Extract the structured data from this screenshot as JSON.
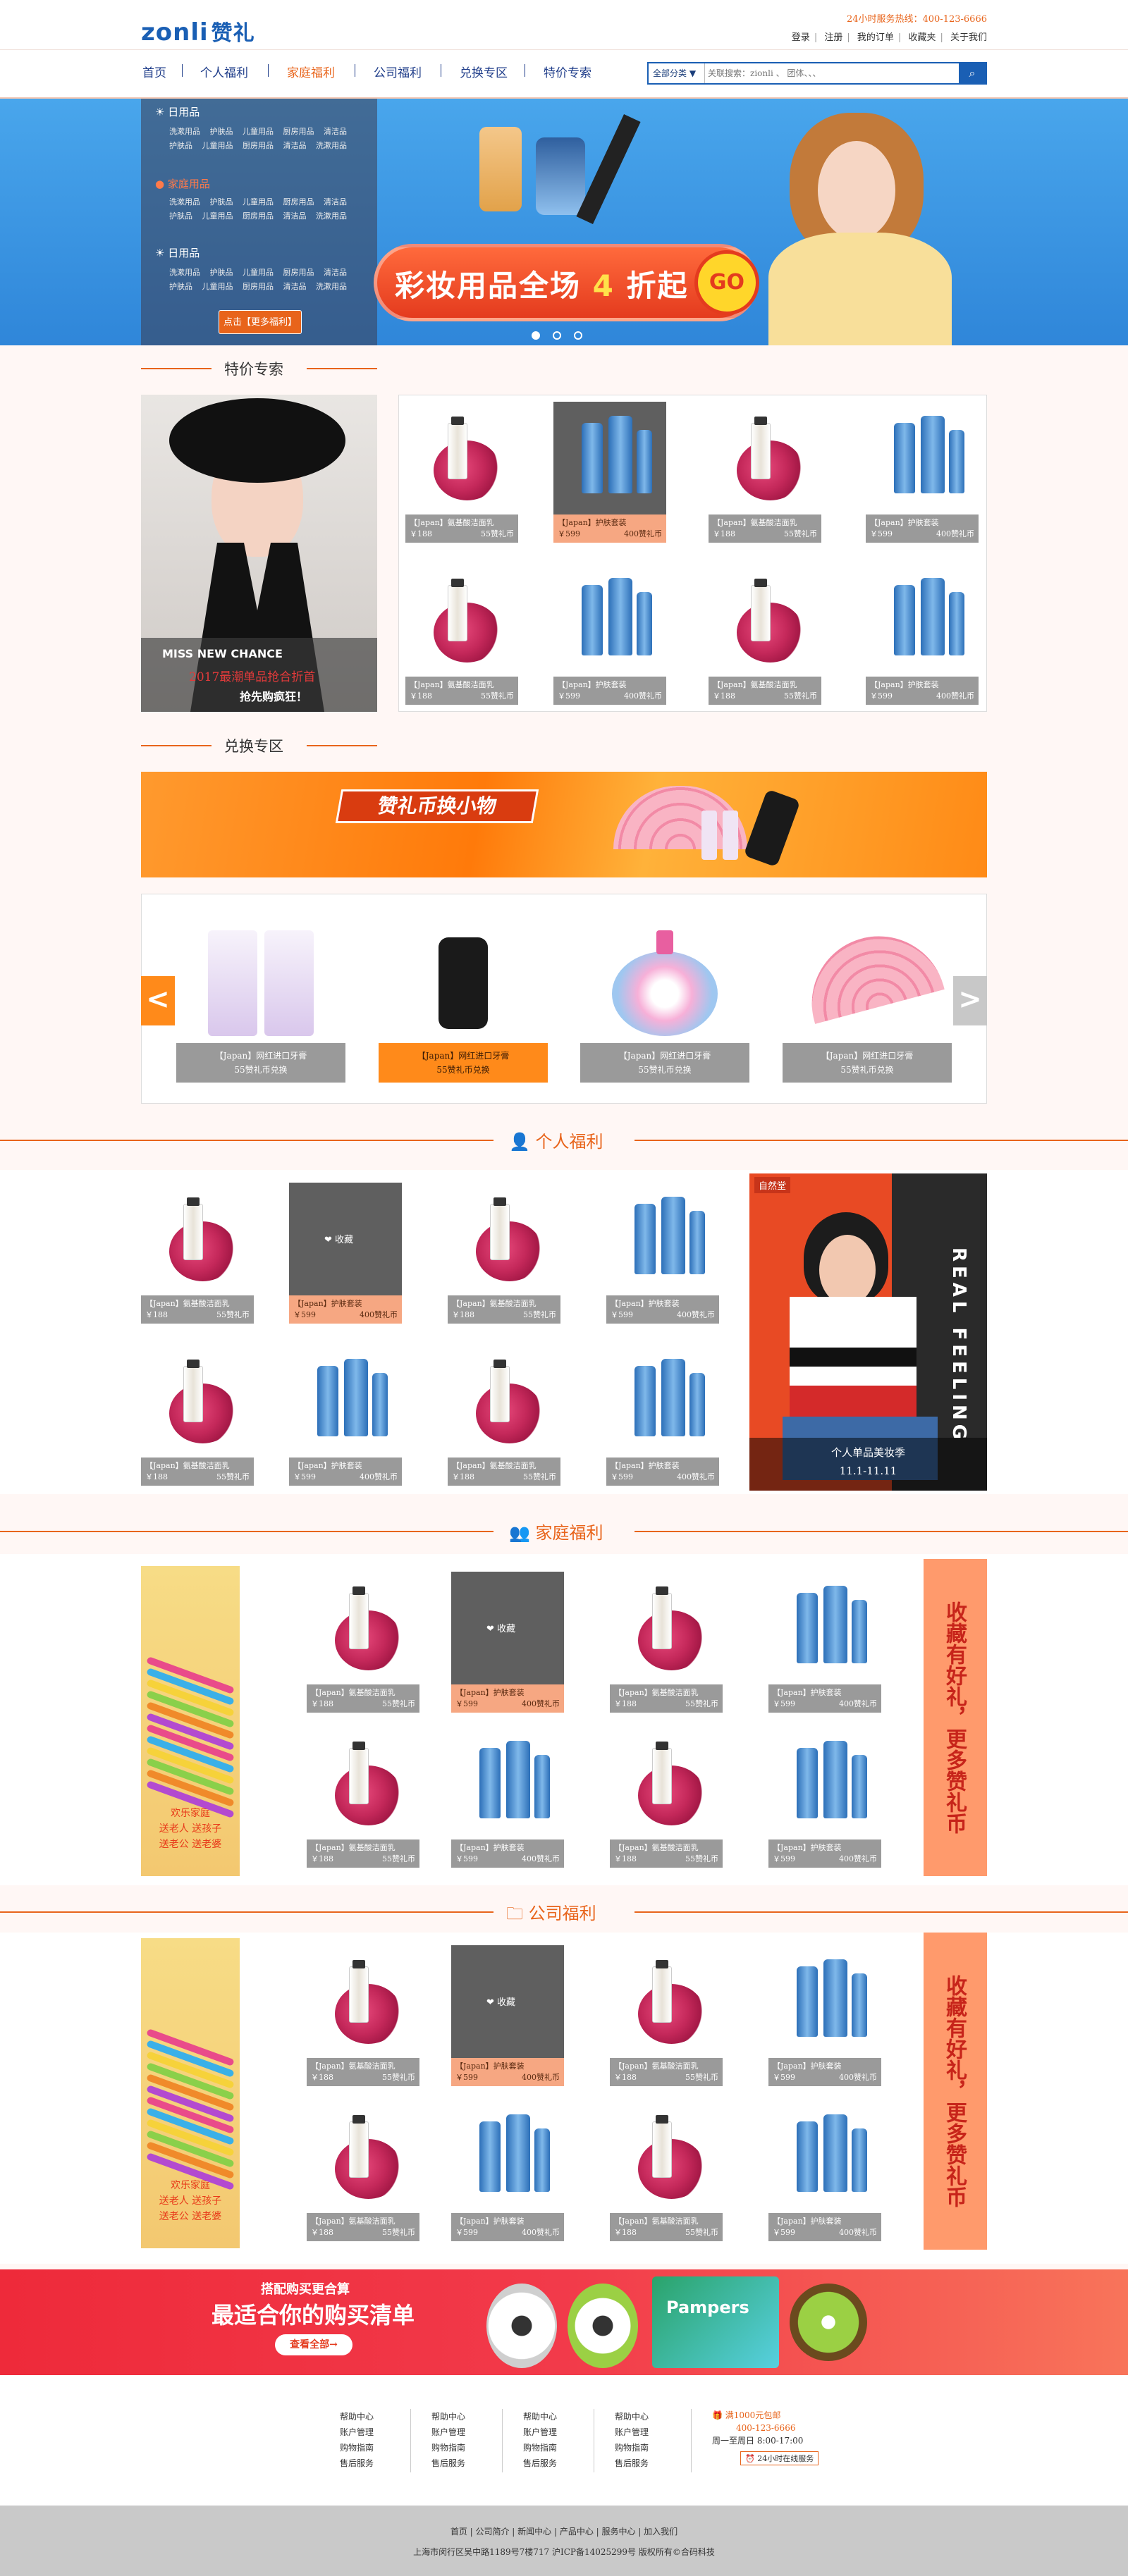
{
  "header": {
    "logo_text": "zonli",
    "logo_cn": "赞礼",
    "hotline": "24小时服务热线：400-123-6666",
    "links": [
      "登录",
      "注册",
      "我的订单",
      "收藏夹",
      "关于我们"
    ]
  },
  "nav": {
    "items": [
      "首页",
      "个人福利",
      "家庭福利",
      "公司福利",
      "兑换专区",
      "特价专索"
    ],
    "active_index": 2,
    "search_category": "全部分类 ▼",
    "search_placeholder": "关联搜索：zionli 、 团体、、、",
    "search_icon": "search-icon"
  },
  "banner": {
    "menu": [
      {
        "title": "日用品",
        "rows": [
          "洗漱用品 护肤品 儿童用品 厨房用品 清洁品",
          "护肤品 儿童用品 厨房用品 清洁品 洗漱用品"
        ]
      },
      {
        "title": "家庭用品",
        "rows": [
          "洗漱用品 护肤品 儿童用品 厨房用品 清洁品",
          "护肤品 儿童用品 厨房用品 清洁品 洗漱用品"
        ]
      },
      {
        "title": "日用品",
        "rows": [
          "洗漱用品 护肤品 儿童用品 厨房用品 清洁品",
          "护肤品 儿童用品 厨房用品 清洁品 洗漱用品"
        ]
      }
    ],
    "more_button": "点击【更多福利】",
    "headline_a": "彩妆用品全场",
    "headline_num": "4",
    "headline_b": "折起",
    "go": "GO"
  },
  "special": {
    "title": "特价专索",
    "promo_en": "MISS NEW CHANCE",
    "promo_red": "2017最潮单品抢合折首",
    "promo_white": "抢先购疯狂！",
    "products": [
      {
        "name": "【Japan】氨基酸洁面乳",
        "price": "￥188",
        "points": "55赞礼币",
        "type": "rose",
        "hot": false
      },
      {
        "name": "【Japan】护肤套装",
        "price": "￥599",
        "points": "400赞礼币",
        "type": "bottles",
        "hot": true
      },
      {
        "name": "【Japan】氨基酸洁面乳",
        "price": "￥188",
        "points": "55赞礼币",
        "type": "rose",
        "hot": false
      },
      {
        "name": "【Japan】护肤套装",
        "price": "￥599",
        "points": "400赞礼币",
        "type": "bottles",
        "hot": false
      },
      {
        "name": "【Japan】氨基酸洁面乳",
        "price": "￥188",
        "points": "55赞礼币",
        "type": "rose",
        "hot": false
      },
      {
        "name": "【Japan】护肤套装",
        "price": "￥599",
        "points": "400赞礼币",
        "type": "bottles",
        "hot": false
      },
      {
        "name": "【Japan】氨基酸洁面乳",
        "price": "￥188",
        "points": "55赞礼币",
        "type": "rose",
        "hot": false
      },
      {
        "name": "【Japan】护肤套装",
        "price": "￥599",
        "points": "400赞礼币",
        "type": "bottles",
        "hot": false
      }
    ]
  },
  "exchange": {
    "title": "兑换专区",
    "banner_text": "赞礼币换小物",
    "items": [
      {
        "name": "【Japan】网红进口牙膏",
        "points": "55赞礼币兑换",
        "hot": false
      },
      {
        "name": "【Japan】网红进口牙膏",
        "points": "55赞礼币兑换",
        "hot": true
      },
      {
        "name": "【Japan】网红进口牙膏",
        "points": "55赞礼币兑换",
        "hot": false
      },
      {
        "name": "【Japan】网红进口牙膏",
        "points": "55赞礼币兑换",
        "hot": false
      }
    ],
    "prev": "<",
    "next": ">"
  },
  "personal": {
    "title": "个人福利",
    "fav_label": "❤ 收藏",
    "side_tag": "自然堂",
    "side_vertical": "REAL FEELING",
    "side_caption_1": "个人单品美妆季",
    "side_caption_2": "11.1-11.11"
  },
  "family": {
    "title": "家庭福利",
    "left_caption": [
      "欢乐家庭",
      "送老人 送孩子",
      "送老公 送老婆"
    ],
    "right_text": "收藏有好礼，更多赞礼币"
  },
  "company": {
    "title": "公司福利",
    "left_caption": [
      "欢乐家庭",
      "送老人 送孩子",
      "送老公 送老婆"
    ],
    "right_text": "收藏有好礼，更多赞礼币"
  },
  "bottom_banner": {
    "line1": "搭配购买更合算",
    "line2": "最适合你的购买清单",
    "button": "查看全部→",
    "brand": "Pampers"
  },
  "footer": {
    "columns": [
      [
        "帮助中心",
        "账户管理",
        "购物指南",
        "售后服务"
      ],
      [
        "帮助中心",
        "账户管理",
        "购物指南",
        "售后服务"
      ],
      [
        "帮助中心",
        "账户管理",
        "购物指南",
        "售后服务"
      ],
      [
        "帮助中心",
        "账户管理",
        "购物指南",
        "售后服务"
      ]
    ],
    "free_ship": "满1000元包邮",
    "phone": "400-123-6666",
    "hours": "周一至周日 8:00-17:00",
    "service": "24小时在线服务",
    "bottom_links": "首页 | 公司简介 | 新闻中心 | 产品中心 | 服务中心 | 加入我们",
    "copyright": "上海市闵行区吴中路1189号7楼717 沪ICP备14025299号 版权所有©合码科技"
  },
  "colors": {
    "accent": "#e8641b",
    "nav_blue": "#1f3d8a",
    "brand_blue": "#1a5fb4",
    "bg": "#fff7f5"
  }
}
